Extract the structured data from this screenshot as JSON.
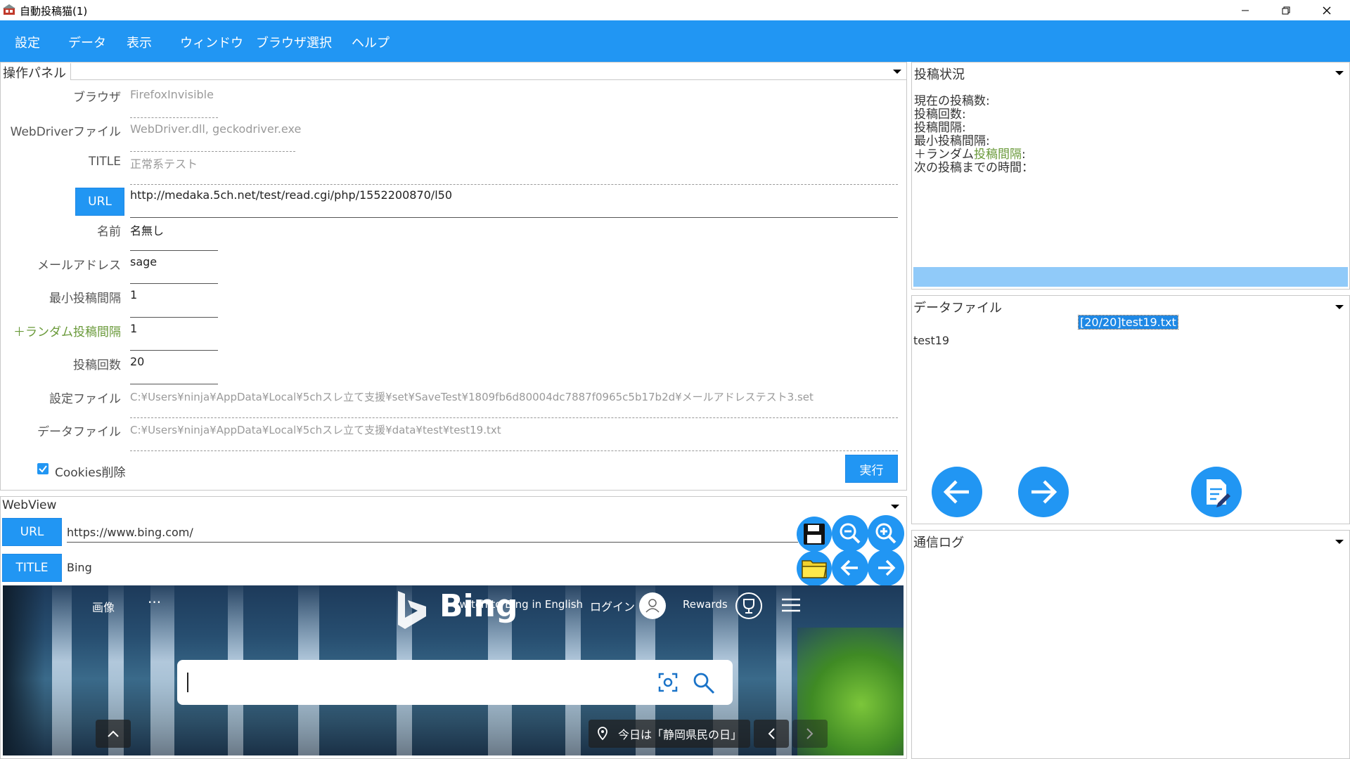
{
  "window": {
    "title": "自動投稿猫(1)",
    "minimize_icon": "minimize-icon",
    "maximize_icon": "restore-icon",
    "close_icon": "close-icon"
  },
  "menu": [
    "設定",
    "データ",
    "表示",
    "ウィンドウ",
    "ブラウザ選択",
    "ヘルプ"
  ],
  "control_panel": {
    "title": "操作パネル",
    "browser_label": "ブラウザ",
    "browser_value": "FirefoxInvisible",
    "webdriver_label": "WebDriverファイル",
    "webdriver_value": "WebDriver.dll, geckodriver.exe",
    "title_label": "TITLE",
    "title_value": "正常系テスト",
    "url_button": "URL",
    "url_value": "http://medaka.5ch.net/test/read.cgi/php/1552200870/l50",
    "name_label": "名前",
    "name_value": "名無し",
    "mail_label": "メールアドレス",
    "mail_value": "sage",
    "min_interval_label": "最小投稿間隔",
    "min_interval_value": "1",
    "random_interval_label": "＋ランダム投稿間隔",
    "random_interval_value": "1",
    "post_count_label": "投稿回数",
    "post_count_value": "20",
    "settings_file_label": "設定ファイル",
    "settings_file_value": "C:¥Users¥ninja¥AppData¥Local¥5chスレ立て支援¥set¥SaveTest¥1809fb6d80004dc7887f0965c5b17b2d¥メールアドレステスト3.set",
    "data_file_label": "データファイル",
    "data_file_value": "C:¥Users¥ninja¥AppData¥Local¥5chスレ立て支援¥data¥test¥test19.txt",
    "cookies_label": "Cookies削除",
    "cookies_checked": true,
    "run_button": "実行"
  },
  "webview": {
    "title": "WebView",
    "url_button": "URL",
    "url_value": "https://www.bing.com/",
    "title_button": "TITLE",
    "title_value": "Bing",
    "icons": [
      "save-icon",
      "zoom-out-icon",
      "zoom-in-icon",
      "folder-icon",
      "back-icon",
      "forward-icon"
    ]
  },
  "bing": {
    "images": "画像",
    "more": "···",
    "logo": "Bing",
    "english": "Switch to Bing in English",
    "login": "ログイン",
    "rewards": "Rewards",
    "today": "今日は「静岡県民の日」"
  },
  "post_status": {
    "title": "投稿状況",
    "current_label": "現在の投稿数:",
    "count_label": "投稿回数:",
    "interval_label": "投稿間隔:",
    "min_interval_label": "最小投稿間隔:",
    "random_prefix": "＋ランダム",
    "random_green": "投稿間隔",
    "random_suffix": ":",
    "next_label": "次の投稿までの時間："
  },
  "data_file_panel": {
    "title": "データファイル",
    "selected": "[20/20]test19.txt",
    "content": "test19"
  },
  "comm_log": {
    "title": "通信ログ"
  },
  "colors": {
    "accent": "#2196f3",
    "progress": "#90caf9",
    "highlight": "#1e88e5"
  }
}
